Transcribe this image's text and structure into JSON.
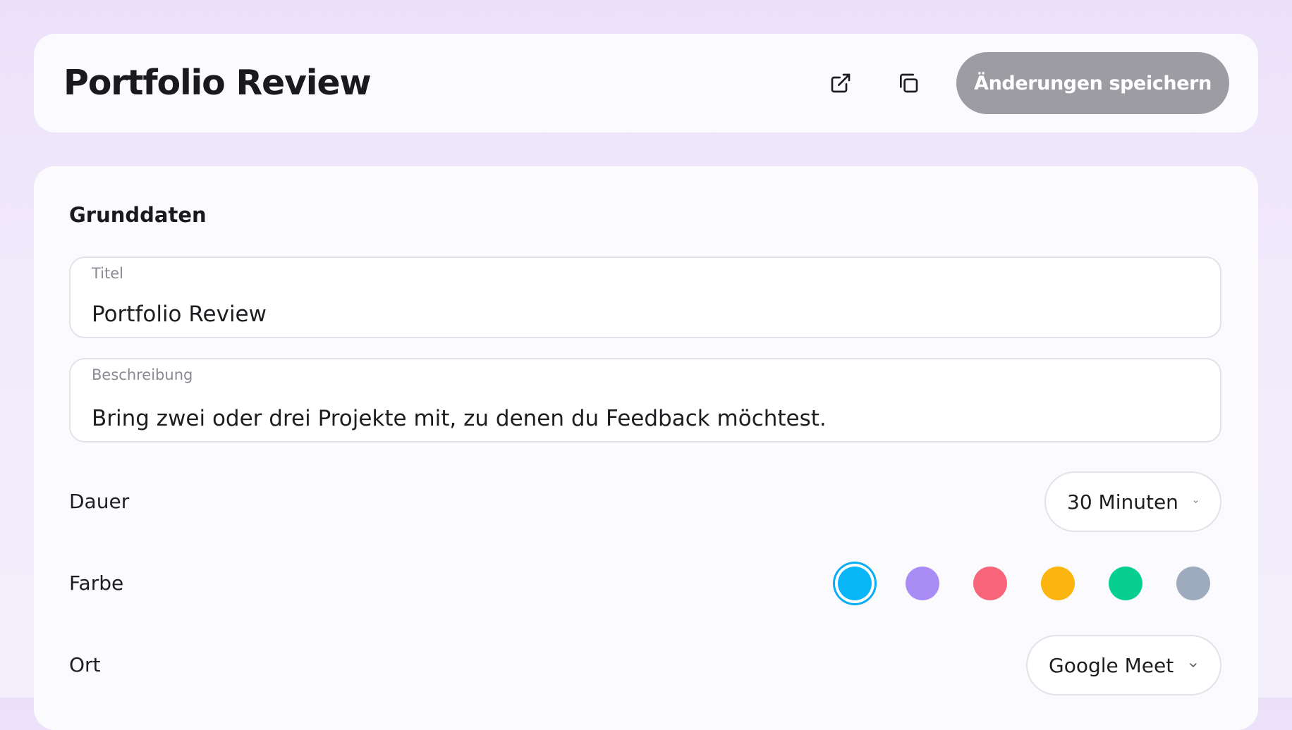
{
  "header": {
    "title": "Portfolio Review",
    "save_label": "Änderungen speichern",
    "icons": [
      "external-link-icon",
      "copy-icon"
    ]
  },
  "basic": {
    "section_title": "Grunddaten",
    "title_field": {
      "label": "Titel",
      "value": "Portfolio Review"
    },
    "description_field": {
      "label": "Beschreibung",
      "value": "Bring zwei oder drei Projekte mit, zu denen du Feedback möchtest."
    },
    "duration": {
      "label": "Dauer",
      "value": "30 Minuten"
    },
    "color": {
      "label": "Farbe",
      "options": [
        "#08b6f7",
        "#a98bf5",
        "#f86479",
        "#fbb50e",
        "#07d08f",
        "#9eaabd"
      ],
      "selected_index": 0
    },
    "location": {
      "label": "Ort",
      "value": "Google Meet"
    }
  }
}
